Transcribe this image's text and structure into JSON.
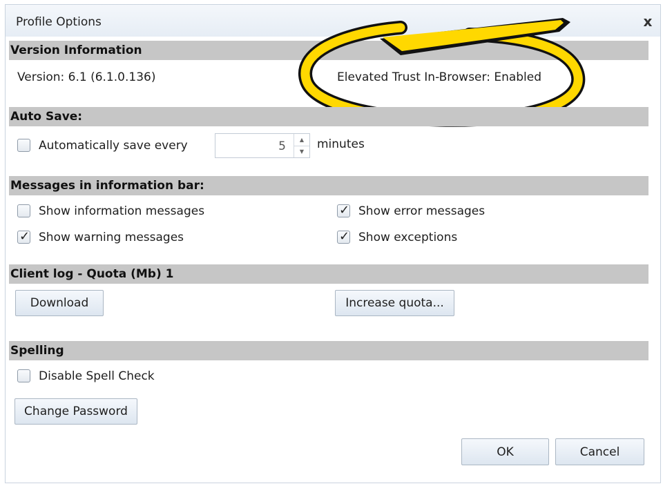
{
  "dialog": {
    "title": "Profile Options",
    "close_glyph": "x"
  },
  "version": {
    "header": "Version Information",
    "version_text": "Version: 6.1 (6.1.0.136)",
    "elevated_trust": "Elevated Trust In-Browser: Enabled"
  },
  "autosave": {
    "header": "Auto Save:",
    "label": "Automatically save every",
    "checked": false,
    "value": "5",
    "unit": "minutes"
  },
  "messages": {
    "header": "Messages in information bar:",
    "items": [
      {
        "label": "Show information messages",
        "checked": false
      },
      {
        "label": "Show error messages",
        "checked": true
      },
      {
        "label": "Show warning messages",
        "checked": true
      },
      {
        "label": "Show exceptions",
        "checked": true
      }
    ]
  },
  "clientlog": {
    "header": "Client log - Quota (Mb) 1",
    "download_label": "Download",
    "increase_label": "Increase quota..."
  },
  "spelling": {
    "header": "Spelling",
    "disable_label": "Disable Spell Check",
    "disable_checked": false
  },
  "buttons": {
    "change_password": "Change Password",
    "ok": "OK",
    "cancel": "Cancel"
  },
  "check_glyph": "✓",
  "colors": {
    "callout_yellow": "#ffd800",
    "section_gray": "#c6c6c6"
  }
}
